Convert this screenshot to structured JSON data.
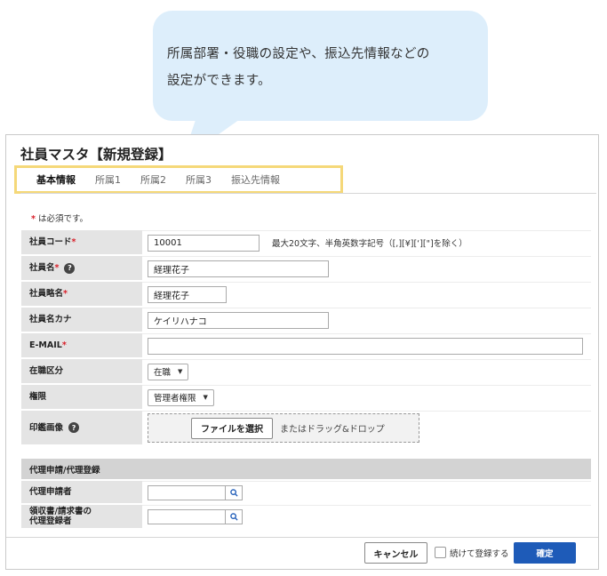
{
  "callout": {
    "line1": "所属部署・役職の設定や、振込先情報などの",
    "line2": "設定ができます。"
  },
  "window": {
    "title": "社員マスタ【新規登録】"
  },
  "tabs": [
    "基本情報",
    "所属1",
    "所属2",
    "所属3",
    "振込先情報"
  ],
  "required_note": "は必須です。",
  "required_star": "*",
  "fields": {
    "employee_code": {
      "label": "社員コード",
      "value": "10001",
      "hint": "最大20文字、半角英数字記号（[,][¥][‘][\"]を除く）"
    },
    "employee_name": {
      "label": "社員名",
      "value": "経理花子"
    },
    "employee_short": {
      "label": "社員略名",
      "value": "経理花子"
    },
    "employee_kana": {
      "label": "社員名カナ",
      "value": "ケイリハナコ"
    },
    "email": {
      "label": "E-MAIL",
      "value": ""
    },
    "employment_status": {
      "label": "在職区分",
      "selected": "在職"
    },
    "permission": {
      "label": "権限",
      "selected": "管理者権限"
    },
    "seal_image": {
      "label": "印鑑画像",
      "button": "ファイルを選択",
      "drop_text": "またはドラッグ&ドロップ"
    }
  },
  "proxy": {
    "section_title": "代理申請/代理登録",
    "applicant_label": "代理申請者",
    "registrant_label_1": "領収書/請求書の",
    "registrant_label_2": "代理登録者"
  },
  "footer": {
    "cancel": "キャンセル",
    "continue_label": "続けて登録する",
    "confirm": "確定"
  },
  "colors": {
    "accent": "#1e5bb8",
    "required": "#d9202a",
    "tab_highlight": "#f5d879",
    "callout_bg": "#ddeefb"
  }
}
